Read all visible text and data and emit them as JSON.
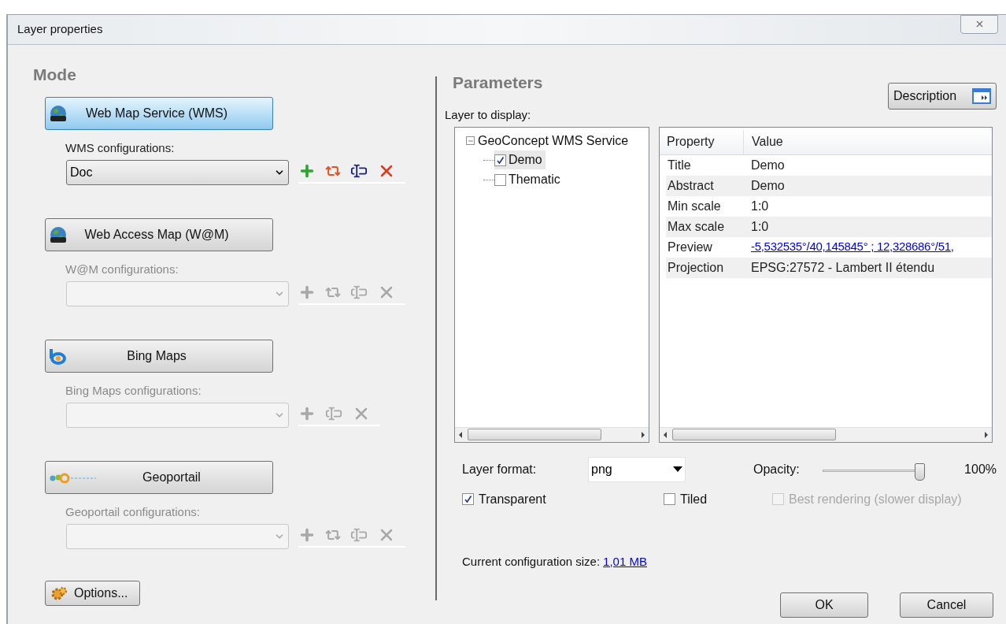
{
  "window": {
    "title": "Layer properties"
  },
  "mode": {
    "heading": "Mode",
    "sections": [
      {
        "kind": "wms",
        "label": "Web Map Service (WMS)",
        "selected": true,
        "config_label": "WMS configurations:",
        "value": "Doc",
        "disabled": false,
        "actions": [
          {
            "kind": "add"
          },
          {
            "kind": "refresh"
          },
          {
            "kind": "rename"
          },
          {
            "kind": "delete"
          }
        ]
      },
      {
        "kind": "wam",
        "label": "Web Access Map (W@M)",
        "selected": false,
        "config_label": "W@M configurations:",
        "disabled": true,
        "actions": [
          {
            "kind": "add"
          },
          {
            "kind": "refresh"
          },
          {
            "kind": "rename"
          },
          {
            "kind": "delete"
          }
        ]
      },
      {
        "kind": "bing",
        "label": "Bing Maps",
        "selected": false,
        "config_label": "Bing Maps  configurations:",
        "disabled": true,
        "actions": [
          {
            "kind": "add"
          },
          {
            "kind": "rename"
          },
          {
            "kind": "delete"
          }
        ]
      },
      {
        "kind": "geoportail",
        "label": "Geoportail",
        "selected": false,
        "config_label": "Geoportail configurations:",
        "disabled": true,
        "actions": [
          {
            "kind": "add"
          },
          {
            "kind": "refresh"
          },
          {
            "kind": "rename"
          },
          {
            "kind": "delete"
          }
        ]
      }
    ],
    "options_button": "Options..."
  },
  "parameters": {
    "heading": "Parameters",
    "description_button": "Description",
    "layer_label": "Layer to display:",
    "tree": [
      {
        "label": "GeoConcept WMS Service",
        "expanded": true,
        "children": [
          {
            "label": "Demo",
            "checked": true,
            "selected": true
          },
          {
            "label": "Thematic",
            "checked": false,
            "selected": false
          }
        ]
      }
    ],
    "grid": {
      "columns": [
        "Property",
        "Value"
      ],
      "rows": [
        {
          "kind": "text",
          "property": "Title",
          "value": "Demo"
        },
        {
          "kind": "text",
          "property": "Abstract",
          "value": "Demo"
        },
        {
          "kind": "text",
          "property": "Min scale",
          "value": "1:0"
        },
        {
          "kind": "text",
          "property": "Max scale",
          "value": "1:0"
        },
        {
          "kind": "link",
          "property": "Preview",
          "value": "-5,532535°/40,145845° ; 12,328686°/51,"
        },
        {
          "kind": "text",
          "property": "Projection",
          "value": "EPSG:27572 - Lambert II étendu"
        }
      ]
    },
    "format_label": "Layer format:",
    "format_value": "png",
    "opacity_label": "Opacity:",
    "opacity": {
      "level": 1.0
    },
    "opacity_reading": "100%",
    "checkboxes": [
      {
        "label": "Transparent",
        "checked": true,
        "disabled": false
      },
      {
        "label": "Tiled",
        "checked": false,
        "disabled": false
      },
      {
        "label": "Best rendering (slower display)",
        "checked": false,
        "disabled": true
      }
    ],
    "size_label": "Current configuration size:",
    "size_value": "1,01 MB"
  },
  "buttons": [
    "OK",
    "Cancel"
  ]
}
